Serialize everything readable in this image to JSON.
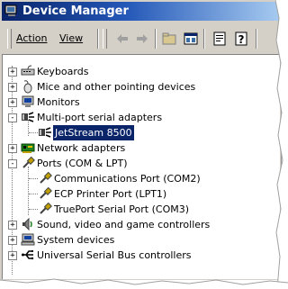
{
  "window": {
    "title": "Device Manager"
  },
  "menu": {
    "action": "Action",
    "view": "View"
  },
  "toolbar": {
    "buttons": [
      "back-icon",
      "forward-icon",
      "up-folder-icon",
      "view-icon",
      "properties-icon",
      "help-icon"
    ]
  },
  "tree": {
    "keyboards": "Keyboards",
    "mice": "Mice and other pointing devices",
    "monitors": "Monitors",
    "multiport": "Multi-port serial adapters",
    "jetstream": "JetStream 8500",
    "network": "Network adapters",
    "ports": "Ports (COM & LPT)",
    "com2": "Communications Port (COM2)",
    "lpt1": "ECP Printer Port (LPT1)",
    "com3": "TruePort Serial Port (COM3)",
    "sound": "Sound, video and game controllers",
    "system": "System devices",
    "usb": "Universal Serial Bus controllers"
  },
  "colors": {
    "title_start": "#0a246a",
    "title_end": "#a6caf0",
    "selection": "#0a246a"
  }
}
